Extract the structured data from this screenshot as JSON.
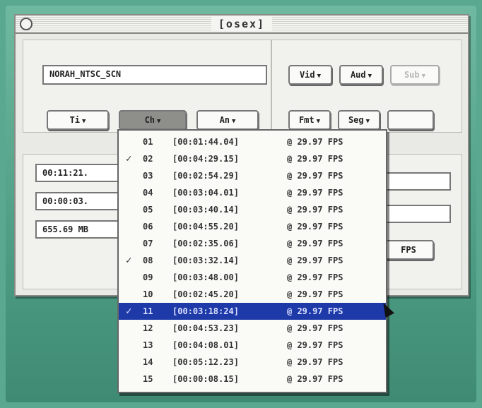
{
  "window": {
    "title": "[osex]"
  },
  "top": {
    "volume_name": "NORAH_NTSC_SCN",
    "vid_label": "Vid",
    "aud_label": "Aud",
    "sub_label": "Sub",
    "ti_label": "Ti",
    "ch_label": "Ch",
    "an_label": "An",
    "fmt_label": "Fmt",
    "seg_label": "Seg"
  },
  "info": {
    "duration": "00:11:21.",
    "start": "00:00:03.",
    "size": "655.69 MB",
    "fps_button": "FPS"
  },
  "chapter_menu": {
    "items": [
      {
        "num": "01",
        "checked": false,
        "timecode": "[00:01:44.04]",
        "fps": "@ 29.97 FPS"
      },
      {
        "num": "02",
        "checked": true,
        "timecode": "[00:04:29.15]",
        "fps": "@ 29.97 FPS"
      },
      {
        "num": "03",
        "checked": false,
        "timecode": "[00:02:54.29]",
        "fps": "@ 29.97 FPS"
      },
      {
        "num": "04",
        "checked": false,
        "timecode": "[00:03:04.01]",
        "fps": "@ 29.97 FPS"
      },
      {
        "num": "05",
        "checked": false,
        "timecode": "[00:03:40.14]",
        "fps": "@ 29.97 FPS"
      },
      {
        "num": "06",
        "checked": false,
        "timecode": "[00:04:55.20]",
        "fps": "@ 29.97 FPS"
      },
      {
        "num": "07",
        "checked": false,
        "timecode": "[00:02:35.06]",
        "fps": "@ 29.97 FPS"
      },
      {
        "num": "08",
        "checked": true,
        "timecode": "[00:03:32.14]",
        "fps": "@ 29.97 FPS"
      },
      {
        "num": "09",
        "checked": false,
        "timecode": "[00:03:48.00]",
        "fps": "@ 29.97 FPS"
      },
      {
        "num": "10",
        "checked": false,
        "timecode": "[00:02:45.20]",
        "fps": "@ 29.97 FPS"
      },
      {
        "num": "11",
        "checked": true,
        "timecode": "[00:03:18:24]",
        "fps": "@ 29.97 FPS"
      },
      {
        "num": "12",
        "checked": false,
        "timecode": "[00:04:53.23]",
        "fps": "@ 29.97 FPS"
      },
      {
        "num": "13",
        "checked": false,
        "timecode": "[00:04:08.01]",
        "fps": "@ 29.97 FPS"
      },
      {
        "num": "14",
        "checked": false,
        "timecode": "[00:05:12.23]",
        "fps": "@ 29.97 FPS"
      },
      {
        "num": "15",
        "checked": false,
        "timecode": "[00:00:08.15]",
        "fps": "@ 29.97 FPS"
      }
    ],
    "selected_index": 10,
    "check_glyph": "✓"
  },
  "colors": {
    "desktop": "#5aa88f",
    "menu_highlight": "#1e3aa8"
  }
}
